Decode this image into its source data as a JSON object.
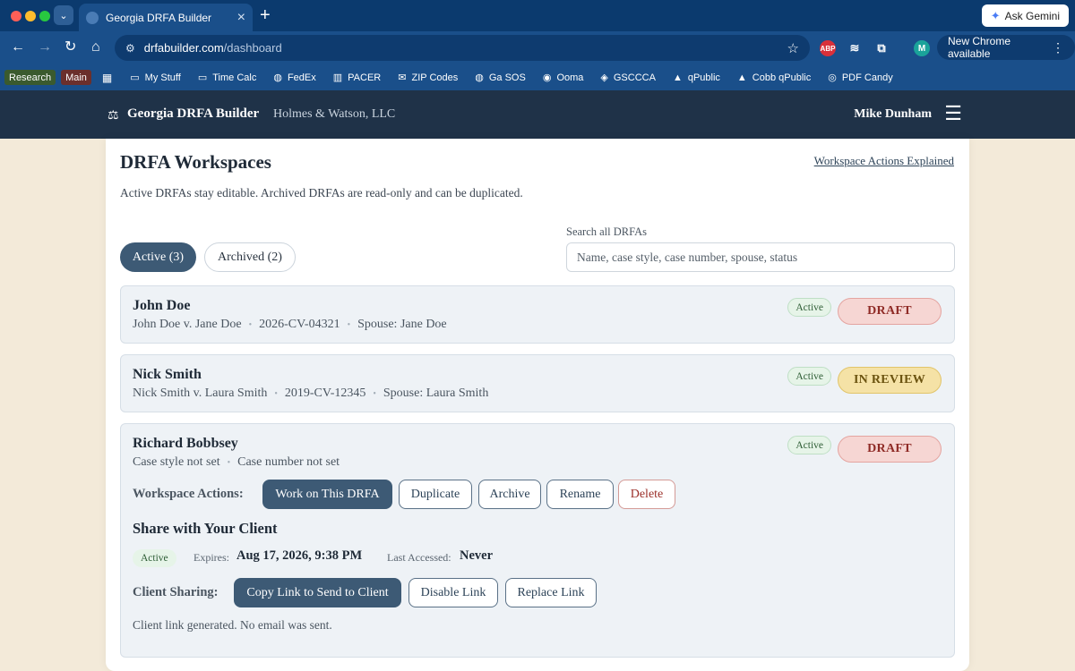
{
  "browser": {
    "tab_title": "Georgia DRFA Builder",
    "url_host": "drfabuilder.com",
    "url_path": "/dashboard",
    "ask_gemini": "Ask Gemini",
    "update_label": "New Chrome available",
    "profile_initial": "M",
    "ext_abp": "ABP",
    "bookmarks": {
      "chip_research": "Research",
      "chip_main": "Main",
      "items": [
        "My Stuff",
        "Time Calc",
        "FedEx",
        "PACER",
        "ZIP Codes",
        "Ga SOS",
        "Ooma",
        "GSCCCA",
        "qPublic",
        "Cobb qPublic",
        "PDF Candy"
      ]
    }
  },
  "header": {
    "brand": "Georgia DRFA Builder",
    "firm": "Holmes & Watson, LLC",
    "user": "Mike Dunham"
  },
  "page": {
    "title": "DRFA Workspaces",
    "explain_link": "Workspace Actions Explained",
    "subtitle": "Active DRFAs stay editable. Archived DRFAs are read-only and can be duplicated.",
    "tab_active": "Active (3)",
    "tab_archived": "Archived (2)",
    "search_label": "Search all DRFAs",
    "search_placeholder": "Name, case style, case number, spouse, status"
  },
  "workspaces": [
    {
      "name": "John Doe",
      "case_style": "John Doe v. Jane Doe",
      "case_number": "2026-CV-04321",
      "spouse": "Spouse: Jane Doe",
      "state": "Active",
      "status": "DRAFT"
    },
    {
      "name": "Nick Smith",
      "case_style": "Nick Smith v. Laura Smith",
      "case_number": "2019-CV-12345",
      "spouse": "Spouse: Laura Smith",
      "state": "Active",
      "status": "IN REVIEW"
    },
    {
      "name": "Richard Bobbsey",
      "case_style": "Case style not set",
      "case_number": "Case number not set",
      "state": "Active",
      "status": "DRAFT",
      "actions_label": "Workspace Actions:",
      "actions": {
        "work": "Work on This DRFA",
        "duplicate": "Duplicate",
        "archive": "Archive",
        "rename": "Rename",
        "delete": "Delete"
      },
      "share": {
        "title": "Share with Your Client",
        "state": "Active",
        "expires_label": "Expires:",
        "expires_value": "Aug 17, 2026, 9:38 PM",
        "accessed_label": "Last Accessed:",
        "accessed_value": "Never",
        "sharing_label": "Client Sharing:",
        "copy_link": "Copy Link to Send to Client",
        "disable_link": "Disable Link",
        "replace_link": "Replace Link",
        "note": "Client link generated. No email was sent."
      }
    }
  ]
}
